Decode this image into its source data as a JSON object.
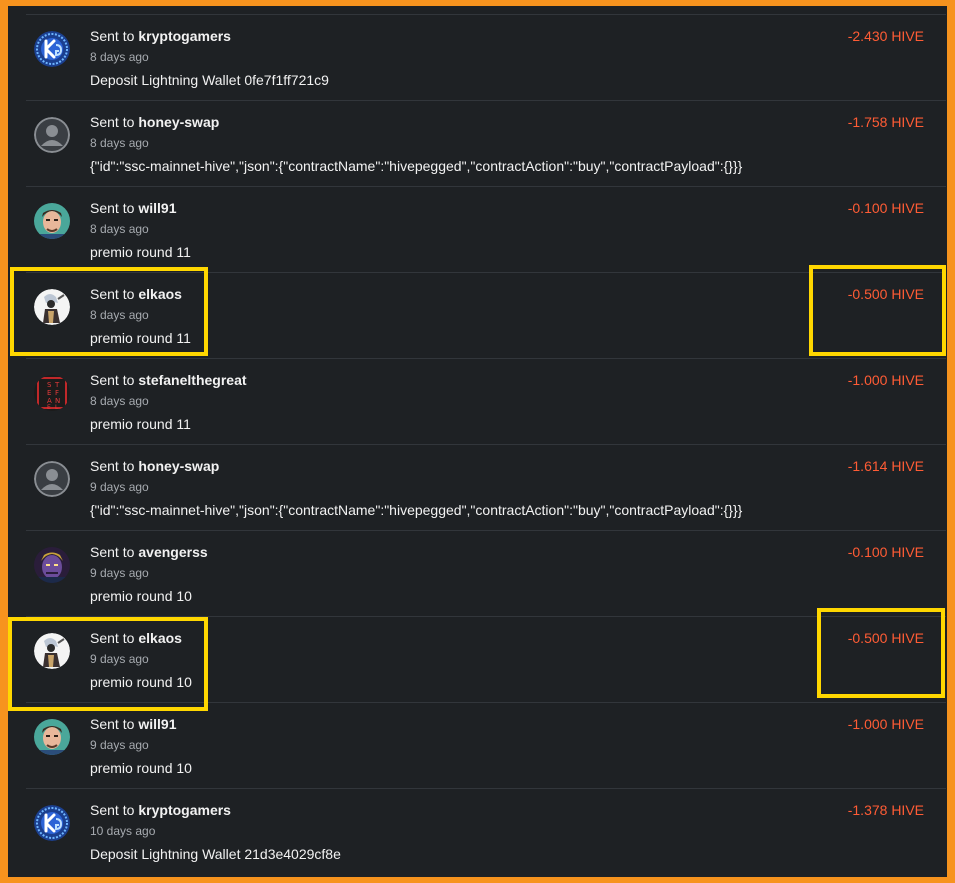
{
  "accent_colors": {
    "amount": "#ff5c35",
    "highlight": "#ffd700",
    "frame": "#f7931e",
    "panel": "#1e2124"
  },
  "transactions": [
    {
      "prefix": "Sent to",
      "user": "kryptogamers",
      "time": "8 days ago",
      "memo": "Deposit Lightning Wallet 0fe7f1ff721c9",
      "amount": "-2.430 HIVE",
      "avatar": "kryptogamers-logo"
    },
    {
      "prefix": "Sent to",
      "user": "honey-swap",
      "time": "8 days ago",
      "memo": "{\"id\":\"ssc-mainnet-hive\",\"json\":{\"contractName\":\"hivepegged\",\"contractAction\":\"buy\",\"contractPayload\":{}}}",
      "amount": "-1.758 HIVE",
      "avatar": "default-user-icon"
    },
    {
      "prefix": "Sent to",
      "user": "will91",
      "time": "8 days ago",
      "memo": "premio round 11",
      "amount": "-0.100 HIVE",
      "avatar": "will91-photo"
    },
    {
      "prefix": "Sent to",
      "user": "elkaos",
      "time": "8 days ago",
      "memo": "premio round 11",
      "amount": "-0.500 HIVE",
      "avatar": "elkaos-character"
    },
    {
      "prefix": "Sent to",
      "user": "stefanelthegreat",
      "time": "8 days ago",
      "memo": "premio round 11",
      "amount": "-1.000 HIVE",
      "avatar": "stefanel-logo"
    },
    {
      "prefix": "Sent to",
      "user": "honey-swap",
      "time": "9 days ago",
      "memo": "{\"id\":\"ssc-mainnet-hive\",\"json\":{\"contractName\":\"hivepegged\",\"contractAction\":\"buy\",\"contractPayload\":{}}}",
      "amount": "-1.614 HIVE",
      "avatar": "default-user-icon"
    },
    {
      "prefix": "Sent to",
      "user": "avengerss",
      "time": "9 days ago",
      "memo": "premio round 10",
      "amount": "-0.100 HIVE",
      "avatar": "avengerss-character"
    },
    {
      "prefix": "Sent to",
      "user": "elkaos",
      "time": "9 days ago",
      "memo": "premio round 10",
      "amount": "-0.500 HIVE",
      "avatar": "elkaos-character"
    },
    {
      "prefix": "Sent to",
      "user": "will91",
      "time": "9 days ago",
      "memo": "premio round 10",
      "amount": "-1.000 HIVE",
      "avatar": "will91-photo"
    },
    {
      "prefix": "Sent to",
      "user": "kryptogamers",
      "time": "10 days ago",
      "memo": "Deposit Lightning Wallet 21d3e4029cf8e",
      "amount": "-1.378 HIVE",
      "avatar": "kryptogamers-logo"
    }
  ],
  "stefanel_logo_letters": [
    "S",
    "T",
    "E",
    "F",
    "A",
    "N",
    "E",
    "L"
  ]
}
